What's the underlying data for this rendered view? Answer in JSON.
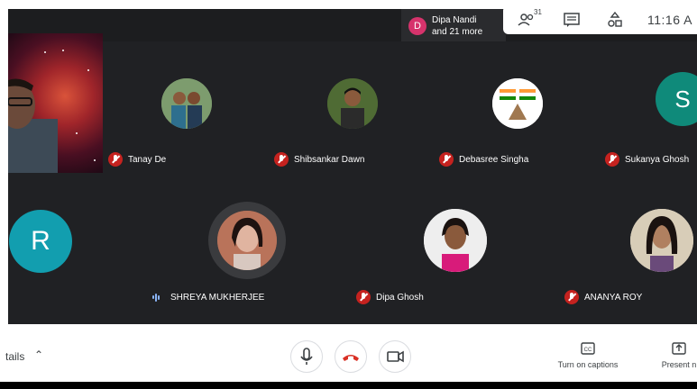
{
  "notification": {
    "avatar_letter": "D",
    "name": "Dipa Nandi",
    "more": "and 21 more",
    "avatar_color": "#d6336c"
  },
  "controls": {
    "people_count": "31",
    "time": "11:16 A"
  },
  "participants": [
    {
      "name": "Tanay De",
      "muted": true
    },
    {
      "name": "Shibsankar Dawn",
      "muted": true
    },
    {
      "name": "Debasree Singha",
      "muted": true
    },
    {
      "name": "Sukanya Ghosh",
      "muted": true
    },
    {
      "name": "SHREYA MUKHERJEE",
      "speaking": true
    },
    {
      "name": "Dipa Ghosh",
      "muted": true
    },
    {
      "name": "ANANYA ROY",
      "muted": true
    }
  ],
  "letter_avatars": {
    "sukanya": {
      "letter": "S",
      "color": "#0f8a7a"
    },
    "r": {
      "letter": "R",
      "color": "#129eaf"
    }
  },
  "bottom": {
    "details_label": "tails",
    "captions_label": "Turn on captions",
    "present_label": "Present n"
  },
  "colors": {
    "stage": "#202124",
    "mute_red": "#c5221f",
    "hangup_red": "#d93025"
  }
}
